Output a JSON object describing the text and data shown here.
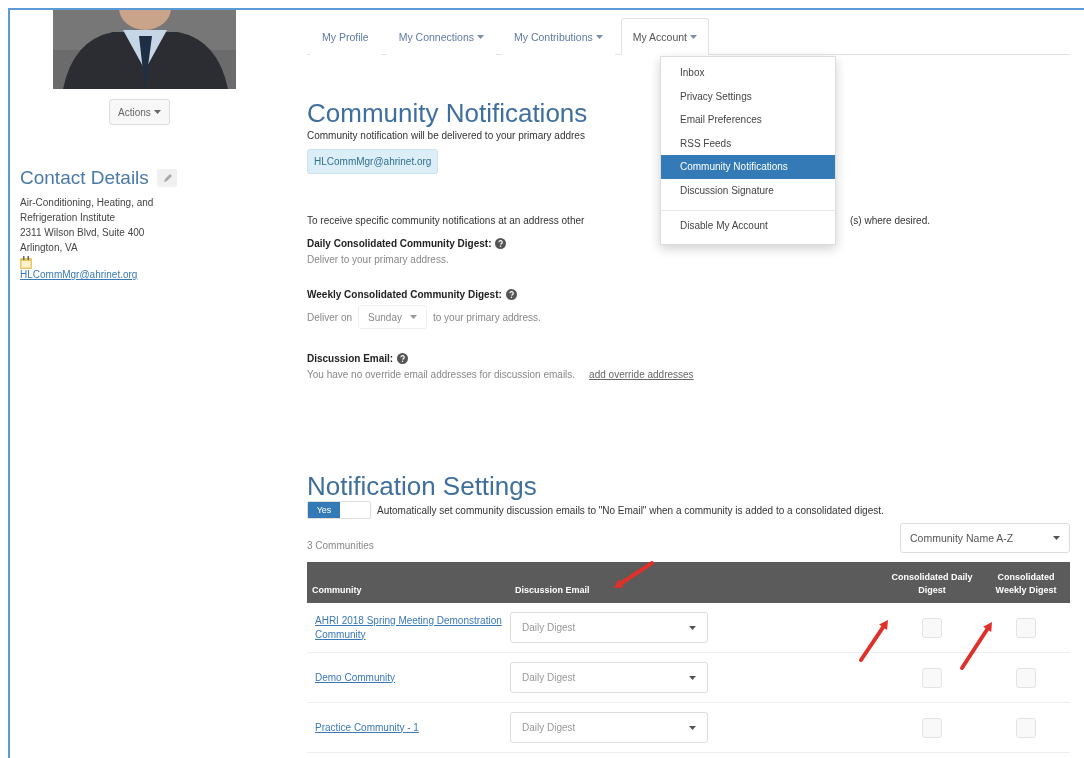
{
  "profile": {
    "actions_button": "Actions"
  },
  "contact_details": {
    "title": "Contact Details",
    "address_lines": [
      "Air-Conditioning, Heating, and",
      "Refrigeration Institute",
      "2311 Wilson Blvd, Suite 400",
      "Arlington, VA"
    ],
    "email": "HLCommMgr@ahrinet.org"
  },
  "nav": [
    {
      "label": "My Profile",
      "dropdown": false,
      "selected": false
    },
    {
      "label": "My Connections",
      "dropdown": true,
      "selected": false
    },
    {
      "label": "My Contributions",
      "dropdown": true,
      "selected": false
    },
    {
      "label": "My Account",
      "dropdown": true,
      "selected": true
    }
  ],
  "account_menu": [
    {
      "label": "Inbox",
      "selected": false,
      "divider_before": false
    },
    {
      "label": "Privacy Settings",
      "selected": false,
      "divider_before": false
    },
    {
      "label": "Email Preferences",
      "selected": false,
      "divider_before": false
    },
    {
      "label": "RSS Feeds",
      "selected": false,
      "divider_before": false
    },
    {
      "label": "Community Notifications",
      "selected": true,
      "divider_before": false
    },
    {
      "label": "Discussion Signature",
      "selected": false,
      "divider_before": false
    },
    {
      "label": "Disable My Account",
      "selected": false,
      "divider_before": true
    }
  ],
  "community_notifications": {
    "title": "Community Notifications",
    "subtitle": "Community notification will be delivered to your primary addres",
    "primary_email": "HLCommMgr@ahrinet.org",
    "info_start": "To receive specific community notifications at an address other",
    "info_end": "(s) where desired.",
    "sections": [
      {
        "kind": "text",
        "title": "Daily Consolidated Community Digest:",
        "text": "Deliver to your primary address."
      },
      {
        "kind": "select",
        "title": "Weekly Consolidated Community Digest:",
        "before": "Deliver on",
        "value": "Sunday",
        "after": "to your primary address."
      },
      {
        "kind": "link",
        "title": "Discussion Email:",
        "text": "You have no override email addresses for discussion emails.",
        "link": "add override addresses"
      }
    ]
  },
  "notification_settings": {
    "title": "Notification Settings",
    "toggle": {
      "label": "Yes",
      "on": true
    },
    "toggle_text": "Automatically set community discussion emails to \"No Email\" when a community is added to a consolidated digest.",
    "count": "3 Communities",
    "sort": "Community Name A-Z",
    "columns": [
      "Community",
      "Discussion Email",
      "Consolidated Daily Digest",
      "Consolidated Weekly Digest"
    ],
    "rows": [
      {
        "community": "AHRI 2018 Spring Meeting Demonstration Community",
        "discussion_email": "Daily Digest",
        "daily_checked": false,
        "weekly_checked": false
      },
      {
        "community": "Demo Community",
        "discussion_email": "Daily Digest",
        "daily_checked": false,
        "weekly_checked": false
      },
      {
        "community": "Practice Community - 1",
        "discussion_email": "Daily Digest",
        "daily_checked": false,
        "weekly_checked": false
      }
    ]
  }
}
